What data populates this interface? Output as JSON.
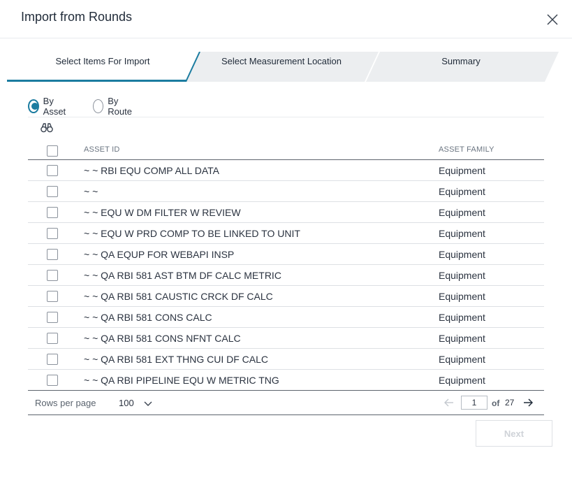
{
  "dialog": {
    "title": "Import from Rounds",
    "close_icon": "close-icon"
  },
  "steps": [
    {
      "label": "Select Items For Import",
      "active": true
    },
    {
      "label": "Select Measurement Location",
      "active": false
    },
    {
      "label": "Summary",
      "active": false
    }
  ],
  "colors": {
    "accent": "#1b7ca0",
    "step_inactive": "#eceef0",
    "text": "#2b3340",
    "muted": "#6a7480"
  },
  "radio": {
    "by_asset": "By Asset",
    "by_route": "By Route",
    "selected": "By Asset"
  },
  "search_icon": "binoculars-icon",
  "table": {
    "columns": [
      "ASSET ID",
      "ASSET FAMILY"
    ],
    "rows": [
      {
        "asset_id": "~ ~ RBI EQU COMP ALL DATA",
        "family": "Equipment"
      },
      {
        "asset_id": "~ ~",
        "family": "Equipment"
      },
      {
        "asset_id": "~ ~ EQU W DM FILTER W REVIEW",
        "family": "Equipment"
      },
      {
        "asset_id": "~ ~ EQU W PRD COMP TO BE LINKED TO UNIT",
        "family": "Equipment"
      },
      {
        "asset_id": "~ ~ QA EQUP FOR WEBAPI INSP",
        "family": "Equipment"
      },
      {
        "asset_id": "~ ~ QA RBI 581 AST BTM DF CALC METRIC",
        "family": "Equipment"
      },
      {
        "asset_id": "~ ~ QA RBI 581 CAUSTIC CRCK DF CALC",
        "family": "Equipment"
      },
      {
        "asset_id": "~ ~ QA RBI 581 CONS CALC",
        "family": "Equipment"
      },
      {
        "asset_id": "~ ~ QA RBI 581 CONS NFNT CALC",
        "family": "Equipment"
      },
      {
        "asset_id": "~ ~ QA RBI 581 EXT THNG CUI DF CALC",
        "family": "Equipment"
      },
      {
        "asset_id": "~ ~ QA RBI PIPELINE EQU W METRIC TNG",
        "family": "Equipment"
      }
    ]
  },
  "pagination": {
    "rows_per_page_label": "Rows per page",
    "rows_per_page": "100",
    "current_page": "1",
    "of_label": "of",
    "total_pages": "27"
  },
  "actions": {
    "next_label": "Next"
  }
}
